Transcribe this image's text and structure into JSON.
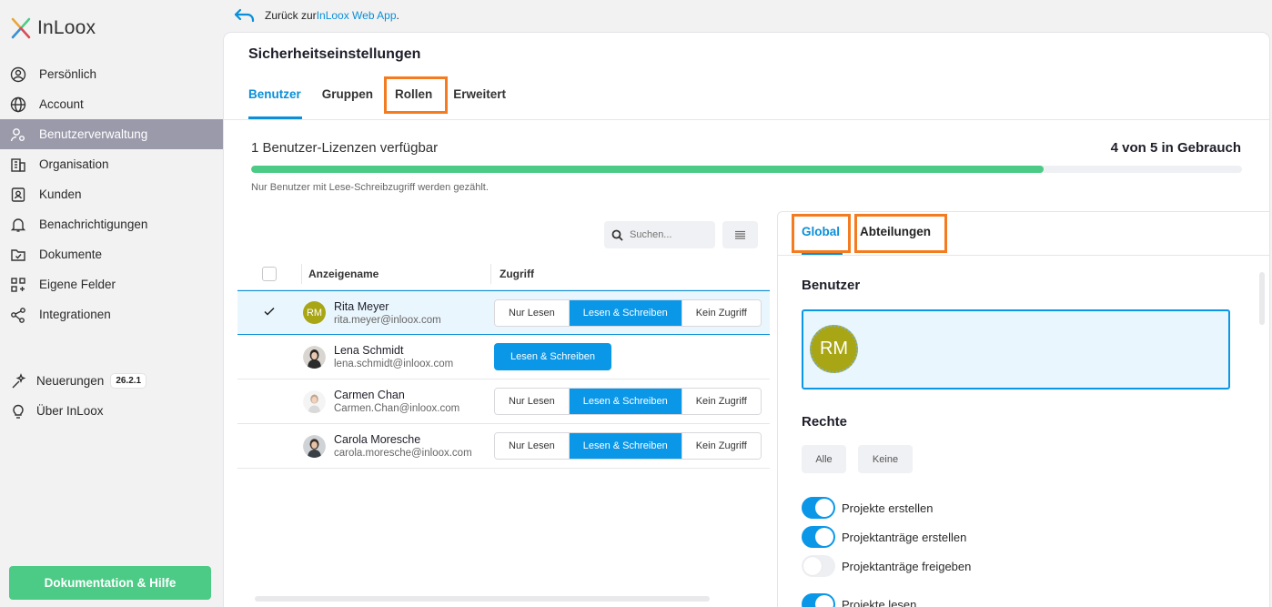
{
  "app": {
    "logo_text": "InLoox"
  },
  "back": {
    "prefix": "Zurück zur ",
    "link": "InLoox Web App",
    "suffix": "."
  },
  "sidebar": {
    "items": [
      {
        "label": "Persönlich",
        "icon": "user-circle-icon"
      },
      {
        "label": "Account",
        "icon": "globe-icon"
      },
      {
        "label": "Benutzerverwaltung",
        "icon": "users-gear-icon",
        "active": true
      },
      {
        "label": "Organisation",
        "icon": "building-icon"
      },
      {
        "label": "Kunden",
        "icon": "contact-card-icon"
      },
      {
        "label": "Benachrichtigungen",
        "icon": "bell-icon"
      },
      {
        "label": "Dokumente",
        "icon": "folder-icon"
      },
      {
        "label": "Eigene Felder",
        "icon": "grid-plus-icon"
      },
      {
        "label": "Integrationen",
        "icon": "share-icon"
      }
    ],
    "news_label": "Neuerungen",
    "version": "26.2.1",
    "about_label": "Über InLoox",
    "doc_button": "Dokumentation & Hilfe"
  },
  "main": {
    "title": "Sicherheitseinstellungen",
    "tabs": [
      "Benutzer",
      "Gruppen",
      "Rollen",
      "Erweitert"
    ],
    "license_text": "1 Benutzer-Lizenzen verfügbar",
    "usage_text": "4 von 5 in Gebrauch",
    "usage_fraction": 0.8,
    "note": "Nur Benutzer mit Lese-Schreibzugriff werden gezählt.",
    "search_placeholder": "Suchen...",
    "table": {
      "headers": [
        "Anzeigename",
        "Zugriff"
      ],
      "access_options": [
        "Nur Lesen",
        "Lesen & Schreiben",
        "Kein Zugriff"
      ],
      "rows": [
        {
          "name": "Rita Meyer",
          "email": "rita.meyer@inloox.com",
          "initials": "RM",
          "access": "Lesen & Schreiben",
          "selected": true
        },
        {
          "name": "Lena Schmidt",
          "email": "lena.schmidt@inloox.com",
          "access": "Lesen & Schreiben"
        },
        {
          "name": "Carmen Chan",
          "email": "Carmen.Chan@inloox.com",
          "access": "Lesen & Schreiben"
        },
        {
          "name": "Carola Moresche",
          "email": "carola.moresche@inloox.com",
          "access": "Lesen & Schreiben"
        }
      ]
    }
  },
  "right_panel": {
    "tabs": [
      "Global",
      "Abteilungen"
    ],
    "users_heading": "Benutzer",
    "user_initials": "RM",
    "rights_heading": "Rechte",
    "all_label": "Alle",
    "none_label": "Keine",
    "permissions": [
      {
        "label": "Projekte erstellen",
        "on": true
      },
      {
        "label": "Projektanträge erstellen",
        "on": true
      },
      {
        "label": "Projektanträge freigeben",
        "on": false
      },
      {
        "label": "Projekte lesen",
        "on": true
      }
    ]
  },
  "colors": {
    "accent": "#0a8fd8",
    "highlight": "#f47b20",
    "success": "#4ccb86",
    "active_nav": "#9a9aab"
  }
}
